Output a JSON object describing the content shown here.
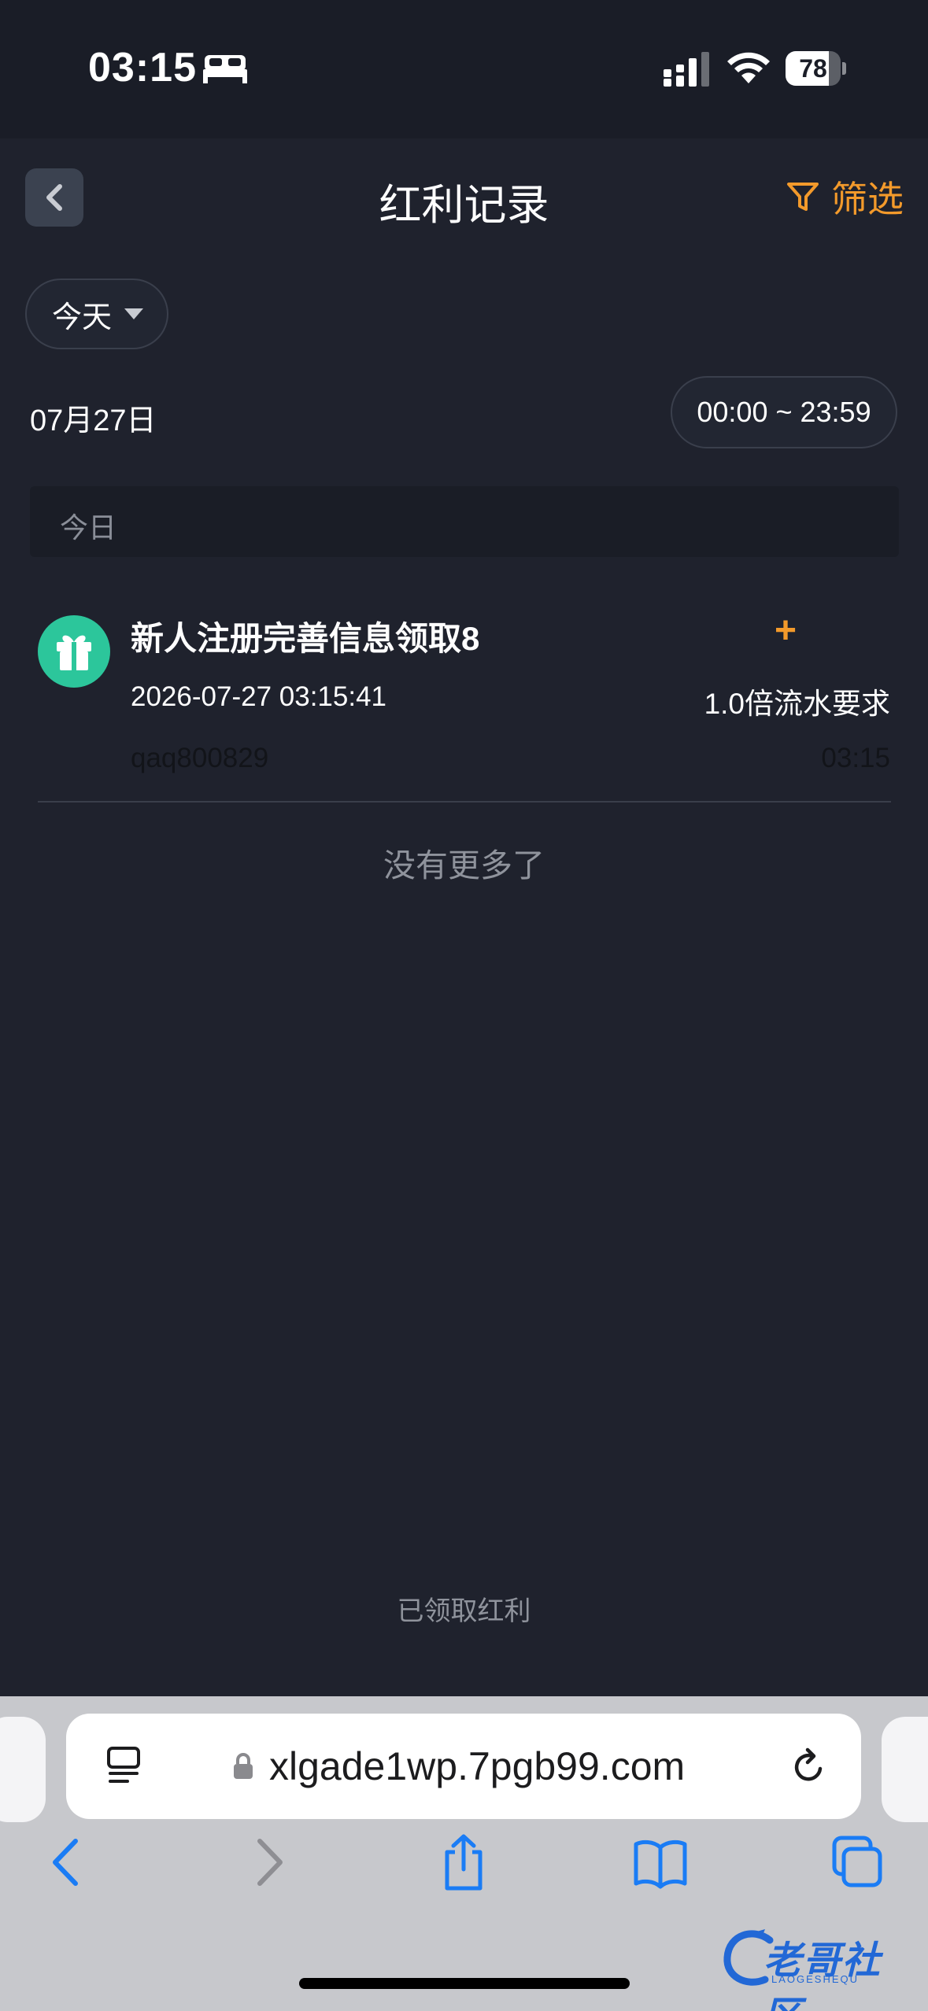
{
  "status_bar": {
    "time": "03:15",
    "battery": "78",
    "battery_level": 0.78
  },
  "header": {
    "title": "红利记录",
    "filter_label": "筛选"
  },
  "controls": {
    "day_select": "今天",
    "date": "07月27日",
    "time_range": "00:00 ~ 23:59"
  },
  "section": {
    "label": "今日"
  },
  "records": [
    {
      "title": "新人注册完善信息领取8",
      "amount_prefix": "+",
      "datetime": "2026-07-27 03:15:41",
      "requirement": "1.0倍流水要求",
      "user": "qaq800829",
      "time": "03:15"
    }
  ],
  "list_end": "没有更多了",
  "footer_link": "已领取红利",
  "browser": {
    "url": "xlgade1wp.7pgb99.com"
  },
  "watermark": {
    "text": "老哥社区",
    "sub": "LAOGESHEQU"
  },
  "colors": {
    "background": "#1f222d",
    "accent": "#f39a2b",
    "gift": "#2cc69b",
    "safari_blue": "#1a7cf5"
  }
}
